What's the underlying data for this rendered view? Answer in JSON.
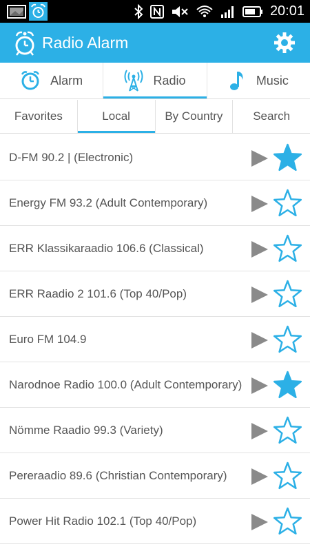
{
  "status_bar": {
    "time": "20:01",
    "icons": [
      "gallery-icon",
      "radio-alarm-notification-icon",
      "bluetooth-icon",
      "nfc-icon",
      "mute-icon",
      "wifi-icon",
      "signal-icon",
      "battery-icon"
    ]
  },
  "app_bar": {
    "title": "Radio Alarm",
    "settings_icon": "gear-icon"
  },
  "main_tabs": [
    {
      "label": "Alarm",
      "icon": "alarm-clock-icon",
      "active": false
    },
    {
      "label": "Radio",
      "icon": "radio-tower-icon",
      "active": true
    },
    {
      "label": "Music",
      "icon": "music-note-icon",
      "active": false
    }
  ],
  "sub_tabs": [
    {
      "label": "Favorites",
      "active": false
    },
    {
      "label": "Local",
      "active": true
    },
    {
      "label": "By Country",
      "active": false
    },
    {
      "label": "Search",
      "active": false
    }
  ],
  "stations": [
    {
      "name": "D-FM 90.2 | (Electronic)",
      "favorite": true
    },
    {
      "name": "Energy FM 93.2 (Adult Contemporary)",
      "favorite": false
    },
    {
      "name": "ERR Klassikaraadio 106.6 (Classical)",
      "favorite": false
    },
    {
      "name": "ERR Raadio 2 101.6 (Top 40/Pop)",
      "favorite": false
    },
    {
      "name": "Euro FM 104.9",
      "favorite": false
    },
    {
      "name": "Narodnoe Radio 100.0 (Adult Contemporary)",
      "favorite": true
    },
    {
      "name": "Nömme Raadio 99.3 (Variety)",
      "favorite": false
    },
    {
      "name": "Pereraadio 89.6 (Christian Contemporary)",
      "favorite": false
    },
    {
      "name": "Power Hit Radio 102.1 (Top 40/Pop)",
      "favorite": false
    }
  ],
  "colors": {
    "accent": "#2cb0e6",
    "play": "#8a8a8a",
    "text": "#555555"
  }
}
